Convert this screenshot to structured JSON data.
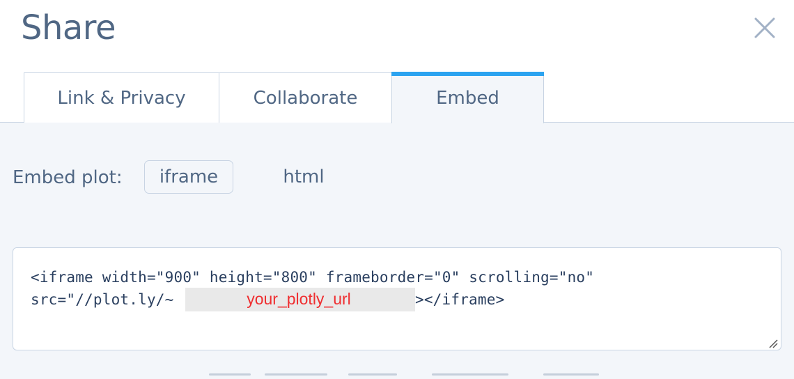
{
  "dialog": {
    "title": "Share",
    "close_icon": "close-icon"
  },
  "tabs": [
    {
      "label": "Link & Privacy",
      "active": false
    },
    {
      "label": "Collaborate",
      "active": false
    },
    {
      "label": "Embed",
      "active": true
    }
  ],
  "embed": {
    "label": "Embed plot:",
    "options": [
      {
        "label": "iframe",
        "selected": true
      },
      {
        "label": "html",
        "selected": false
      }
    ],
    "code": {
      "line1": "<iframe width=\"900\" height=\"800\" frameborder=\"0\" scrolling=\"no\"",
      "line2_start": "src=\"//plot.ly/~",
      "url_placeholder": "your_plotly_url",
      "line2_end": "></iframe>"
    }
  },
  "colors": {
    "accent": "#2ba3f0",
    "text": "#506784",
    "border": "#c8d4e3",
    "panel_bg": "#f3f6fa",
    "redaction": "#ef2e30"
  }
}
